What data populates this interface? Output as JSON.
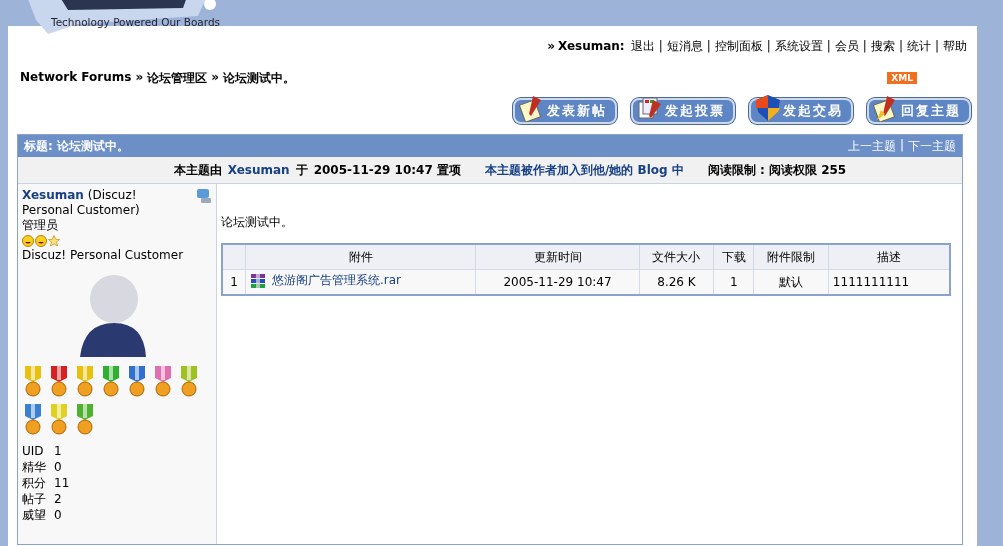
{
  "header": {
    "tagline": "Technology Powered Our Boards"
  },
  "user_nav": {
    "prefix": "»",
    "username": "Xesuman:",
    "separator": "|",
    "links": [
      "退出",
      "短消息",
      "控制面板",
      "系统设置",
      "会员",
      "搜索",
      "统计",
      "帮助"
    ]
  },
  "breadcrumb": {
    "separator": "»",
    "items": [
      "Network Forums",
      "论坛管理区",
      "论坛测试中。"
    ]
  },
  "feed_badge": "XML",
  "action_buttons": [
    {
      "label": "发表新帖",
      "kind": "post"
    },
    {
      "label": "发起投票",
      "kind": "poll"
    },
    {
      "label": "发起交易",
      "kind": "trade"
    },
    {
      "label": "回复主题",
      "kind": "reply"
    }
  ],
  "thread": {
    "title": "标题: 论坛测试中。",
    "nav_separator": "|",
    "nav": [
      "上一主题",
      "下一主题"
    ],
    "info": {
      "pinned_prefix": "本主题由",
      "pinned_user": "Xesuman",
      "pinned_mid": "于",
      "pinned_time": "2005-11-29 10:47 置项",
      "blog": "本主题被作者加入到他/她的 Blog 中",
      "read_limit": "阅读限制 : 阅读权限  255"
    }
  },
  "author": {
    "name": "Xesuman",
    "title": "(Discuz! Personal Customer)",
    "group": "管理员",
    "rank_icons": [
      {
        "kind": "smiley"
      },
      {
        "kind": "smiley"
      },
      {
        "kind": "star"
      }
    ],
    "custom_title": "Discuz! Personal Customer",
    "medals": [
      {
        "color": "#e8c010"
      },
      {
        "color": "#d82020"
      },
      {
        "color": "#e8c010"
      },
      {
        "color": "#30b030"
      },
      {
        "color": "#3070d0"
      },
      {
        "color": "#e070b0"
      },
      {
        "color": "#a0c020"
      },
      {
        "color": "#3a80d0"
      },
      {
        "color": "#e0d020"
      },
      {
        "color": "#50b030"
      }
    ],
    "stats": [
      {
        "label": "UID",
        "value": "1"
      },
      {
        "label": "精华",
        "value": "0"
      },
      {
        "label": "积分",
        "value": "11"
      },
      {
        "label": "帖子",
        "value": "2"
      },
      {
        "label": "威望",
        "value": "0"
      }
    ]
  },
  "post": {
    "message": "论坛测试中。",
    "attachments": {
      "columns": [
        "附件",
        "更新时间",
        "文件大小",
        "下载",
        "附件限制",
        "描述"
      ],
      "rows": [
        {
          "index": "1",
          "name": "悠游阁广告管理系统.rar",
          "updated": "2005-11-29 10:47",
          "size": "8.26 K",
          "downloads": "1",
          "limit": "默认",
          "description": "1111111111"
        }
      ]
    }
  }
}
